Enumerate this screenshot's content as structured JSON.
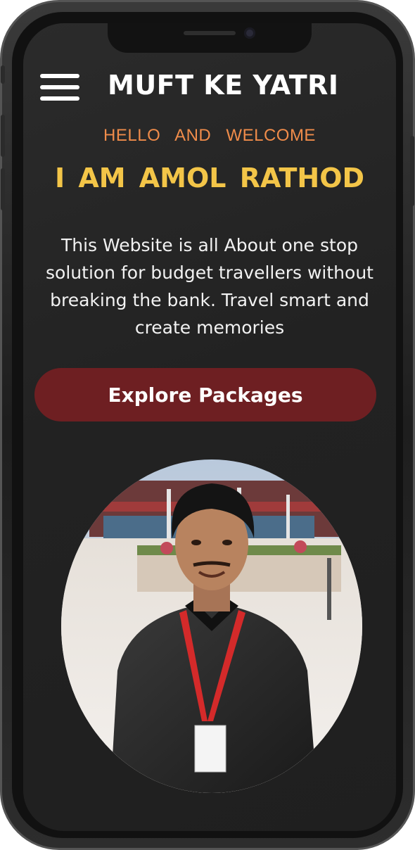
{
  "app": {
    "brand_title": "MUFT KE YATRI"
  },
  "hero": {
    "greeting": "HELLO AND WELCOME",
    "name": "I AM AMOL RATHOD",
    "description": "This Website is all About one stop solution for budget travellers without breaking the bank. Travel smart and create memories",
    "cta_label": "Explore Packages"
  },
  "colors": {
    "screen_bg": "#232323",
    "greeting": "#f08c4a",
    "name": "#f3c548",
    "cta_bg": "#6e1f22",
    "text": "#f2f2f2"
  },
  "icons": {
    "menu": "hamburger-menu-icon"
  }
}
